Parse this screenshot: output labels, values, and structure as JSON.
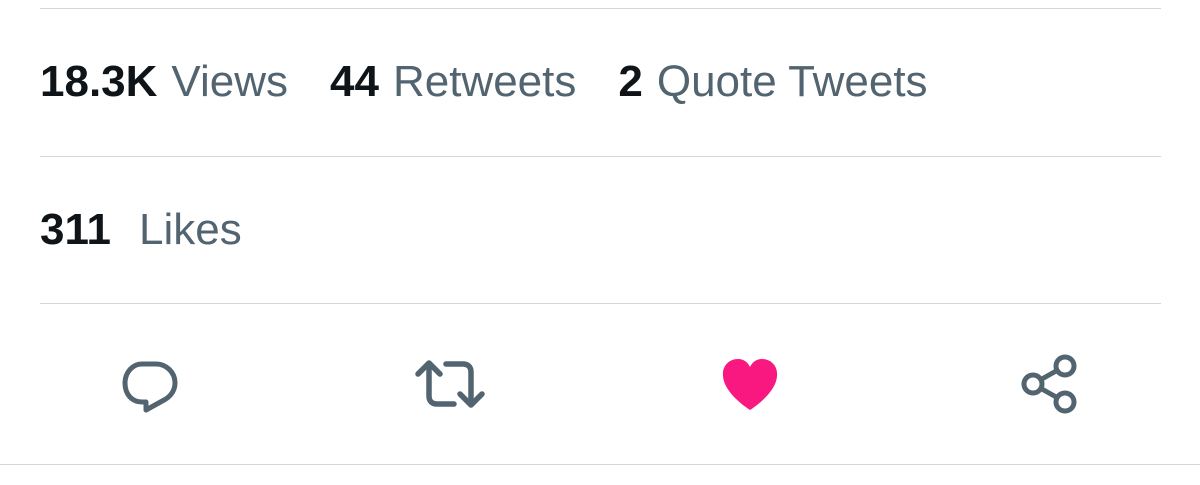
{
  "stats": {
    "views": {
      "count": "18.3K",
      "label": "Views"
    },
    "retweets": {
      "count": "44",
      "label": "Retweets"
    },
    "quotes": {
      "count": "2",
      "label": "Quote Tweets"
    },
    "likes": {
      "count": "311",
      "label": "Likes"
    }
  },
  "actions": [
    {
      "icon": "reply-icon"
    },
    {
      "icon": "retweet-icon"
    },
    {
      "icon": "heart-icon",
      "active": true
    },
    {
      "icon": "share-icon"
    }
  ],
  "colors": {
    "text_primary": "#0f1419",
    "text_secondary": "#536471",
    "divider": "#cfd9de",
    "icon": "#536471",
    "like_active": "#f91880"
  }
}
